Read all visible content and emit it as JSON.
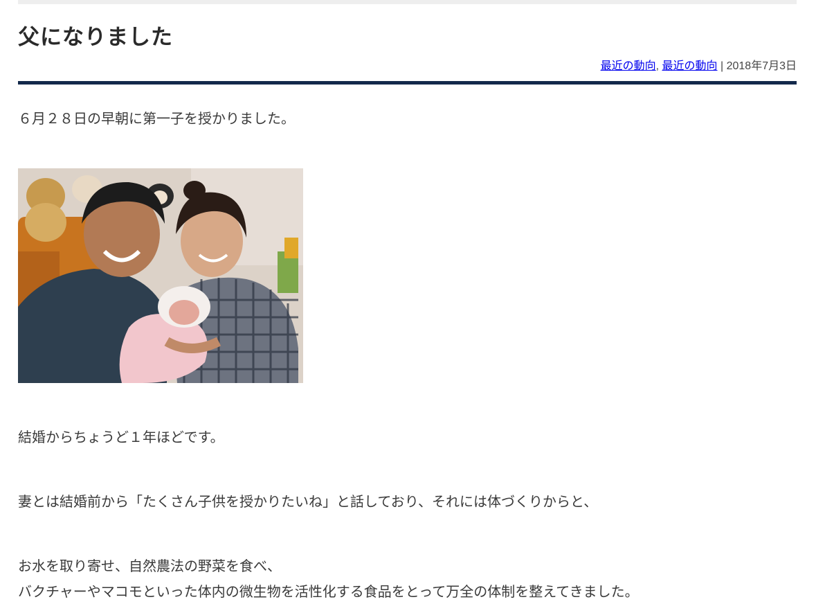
{
  "post": {
    "title": "父になりました",
    "meta": {
      "category_1": "最近の動向",
      "separator_comma": ",",
      "category_2": "最近の動向",
      "separator_bar": "|",
      "date": "2018年7月3日"
    },
    "paragraphs": {
      "p1": "６月２８日の早朝に第一子を授かりました。",
      "p2": "結婚からちょうど１年ほどです。",
      "p3": "妻とは結婚前から「たくさん子供を授かりたいね」と話しており、それには体づくりからと、",
      "p4_line1": "お水を取り寄せ、自然農法の野菜を食べ、",
      "p4_line2": "バクチャーやマコモといった体内の微生物を活性化する食品をとって万全の体制を整えてきました。"
    }
  },
  "colors": {
    "divider": "#13294b",
    "link": "#0000ee",
    "text": "#333333"
  }
}
